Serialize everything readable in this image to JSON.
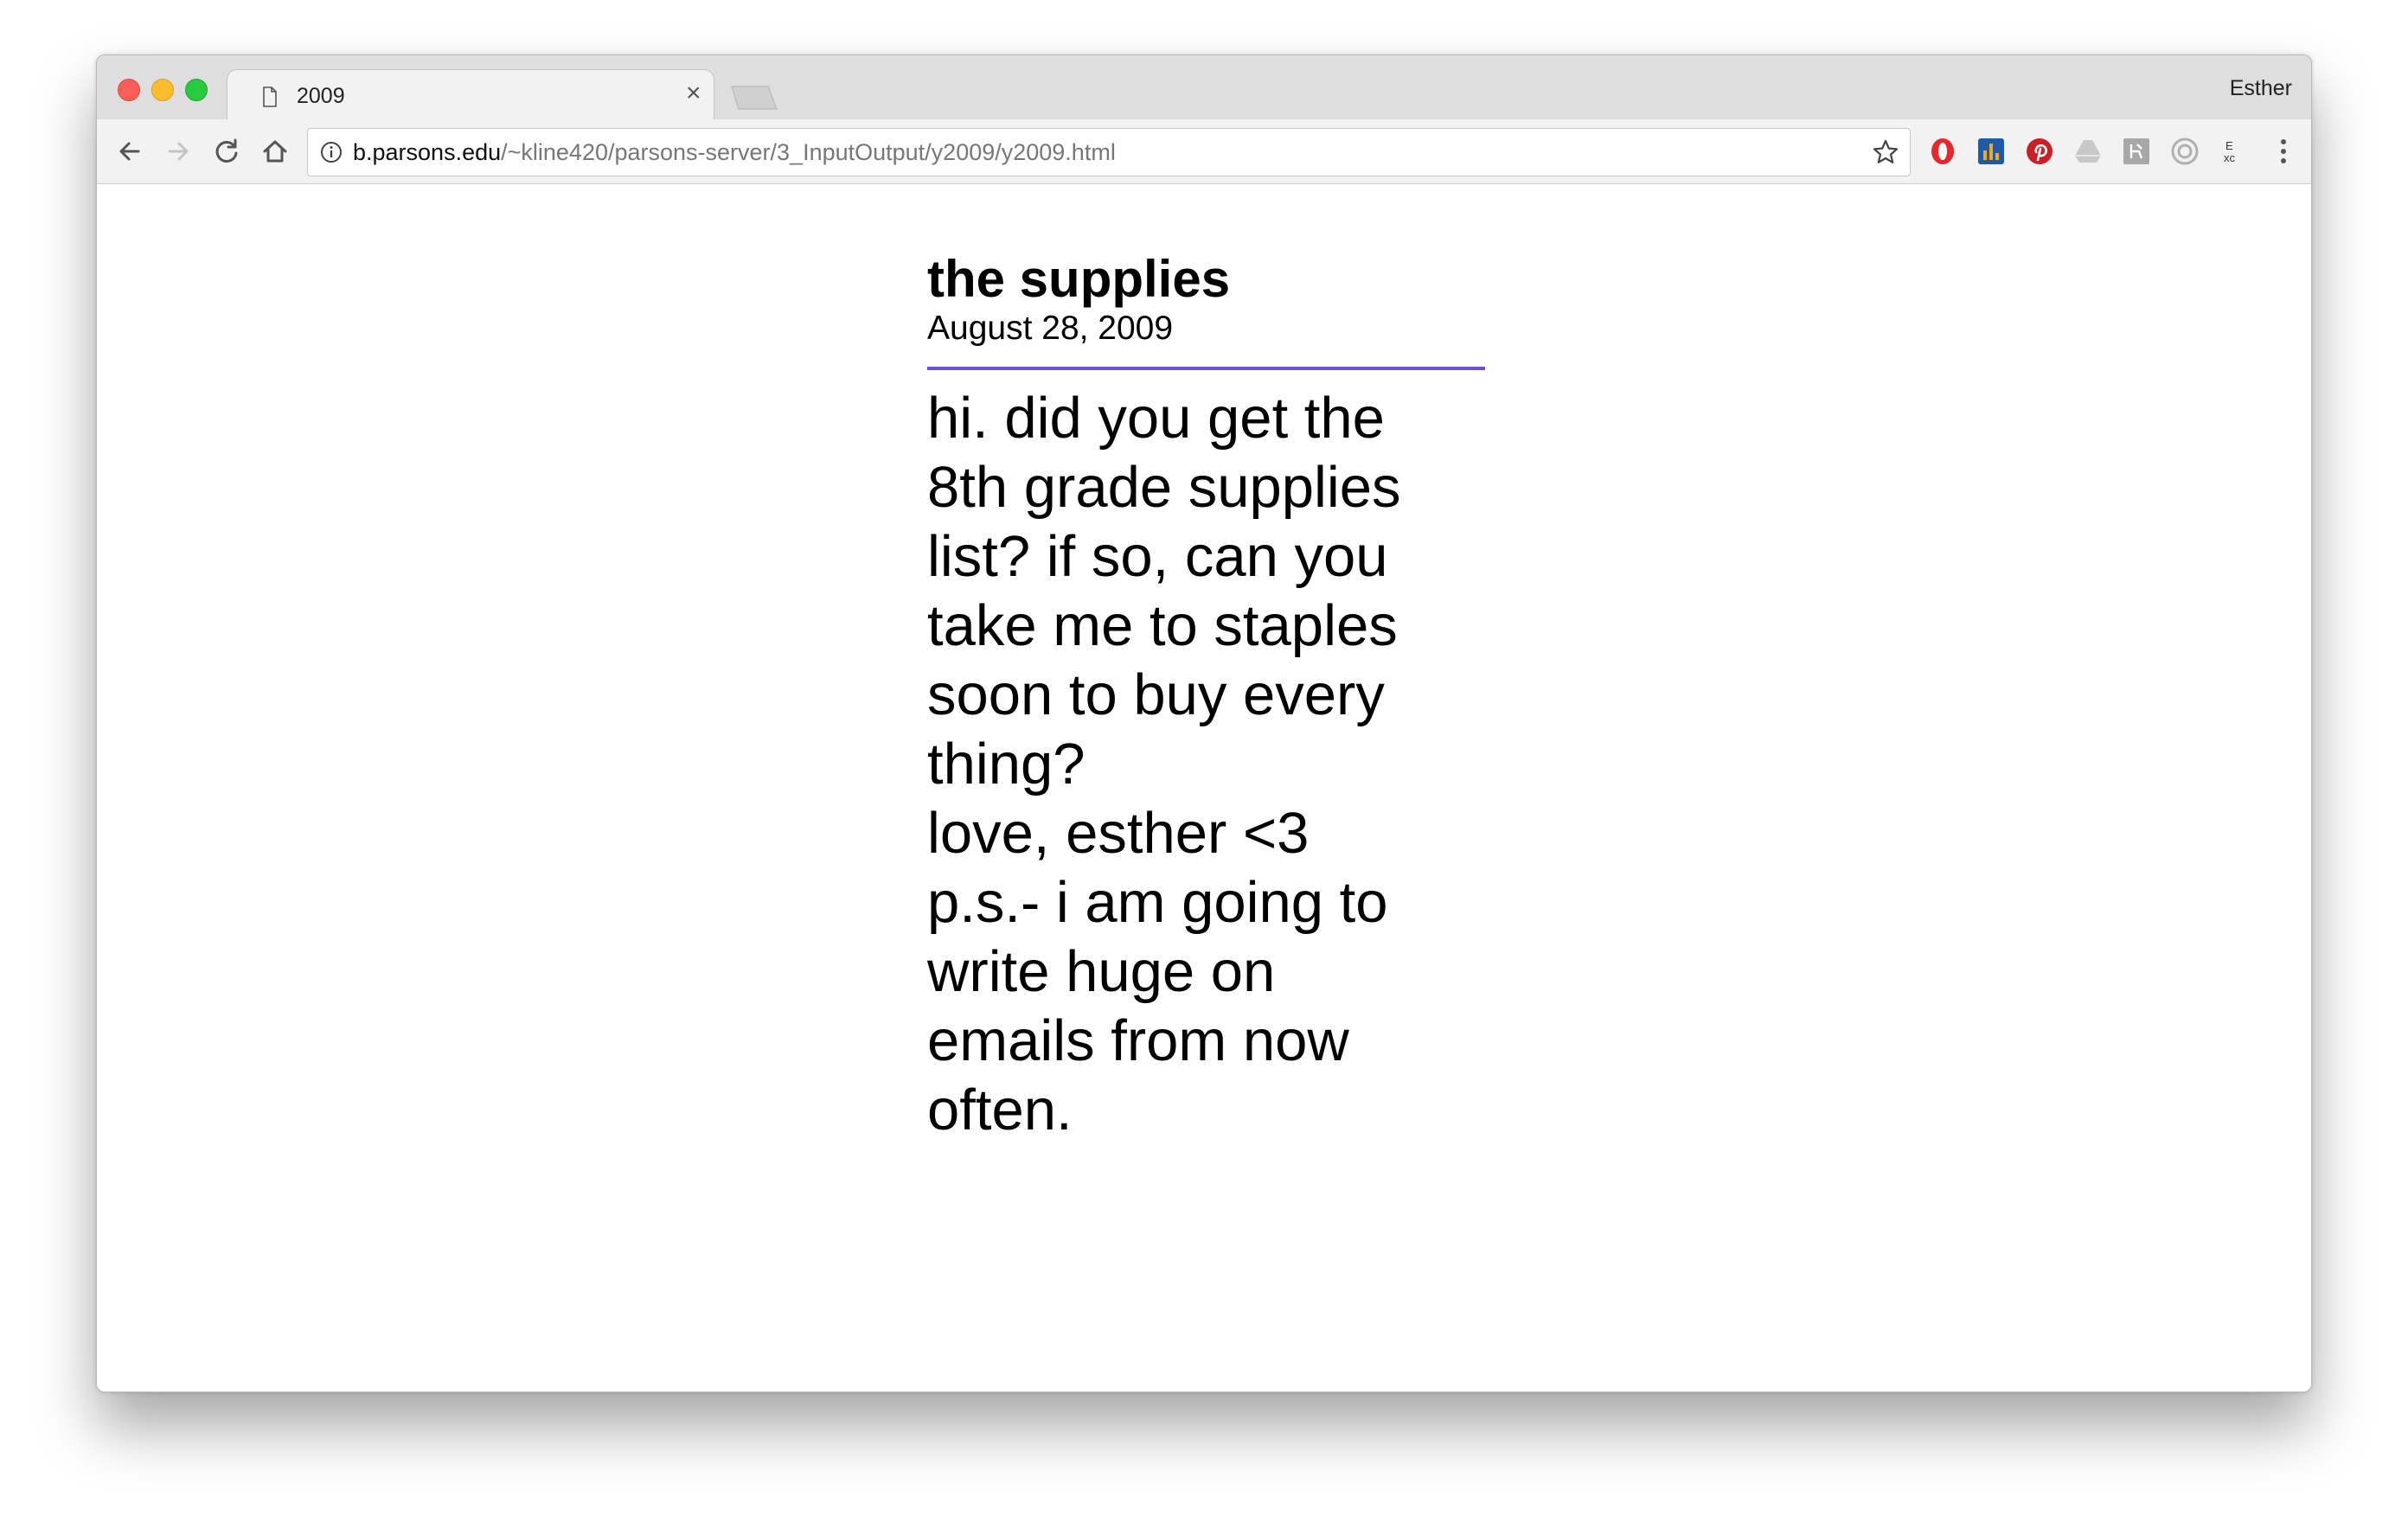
{
  "browser": {
    "tab": {
      "title": "2009",
      "close": "×"
    },
    "profile_name": "Esther",
    "address": {
      "host": "b.parsons.edu",
      "path": "/~kline420/parsons-server/3_InputOutput/y2009/y2009.html"
    },
    "icons": {
      "back": "back-arrow-icon",
      "forward": "forward-arrow-icon",
      "reload": "reload-icon",
      "home": "home-icon",
      "info": "info-icon",
      "bookmark": "star-icon",
      "menu": "kebab-menu-icon"
    },
    "extensions": [
      {
        "name": "opera-extension-icon",
        "color": "#e8262d"
      },
      {
        "name": "chart-extension-icon",
        "color": "#1f5aa6"
      },
      {
        "name": "pinterest-extension-icon",
        "color": "#cb1f27"
      },
      {
        "name": "drive-extension-icon",
        "color": "#c8c8c8"
      },
      {
        "name": "gray-square-extension-icon",
        "color": "#a8a8a8"
      },
      {
        "name": "circle-extension-icon",
        "color": "#b0b0b0"
      },
      {
        "name": "text-extension-icon",
        "color": "#333333"
      }
    ]
  },
  "page": {
    "title": "the supplies",
    "date": "August 28, 2009",
    "divider_color": "#6b4fd8",
    "lines": [
      "hi. did you get the",
      "8th grade supplies",
      "list? if so, can you",
      "take me to staples",
      "soon to buy every",
      "thing?",
      "love, esther <3",
      "p.s.- i am going to",
      "write huge on",
      "emails from now",
      "often."
    ]
  }
}
